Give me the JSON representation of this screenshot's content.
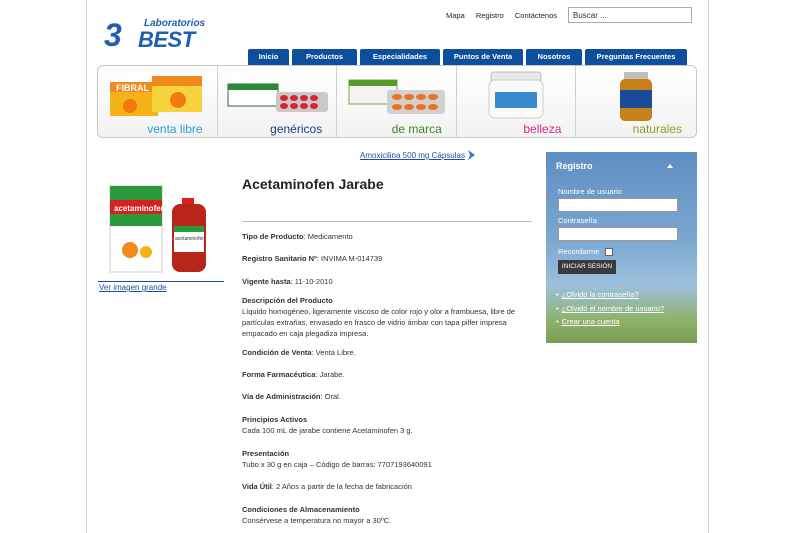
{
  "header": {
    "logo_number": "3",
    "logo_top": "Laboratorios",
    "logo_brand": "BEST",
    "links": [
      "Mapa",
      "Registro",
      "Contáctenos"
    ],
    "search_value": "Buscar ..."
  },
  "nav": {
    "tabs": [
      "Inicio",
      "Productos",
      "Especialidades",
      "Puntos de Venta",
      "Nosotros",
      "Preguntas Frecuentes"
    ]
  },
  "categories": [
    {
      "label": "venta libre",
      "color": "#2a9fd6"
    },
    {
      "label": "genéricos",
      "color": "#1a3f7a"
    },
    {
      "label": "de marca",
      "color": "#3a8a1c"
    },
    {
      "label": "belleza",
      "color": "#d6278a"
    },
    {
      "label": "naturales",
      "color": "#8aa01e"
    }
  ],
  "next_product": "Amoxicilina 500 mg Cápsulas",
  "product": {
    "view_large": "Ver imagen grande",
    "title": "Acetaminofen Jarabe",
    "box_brand": "acetaminofen",
    "bottle_brand": "acetaminofen",
    "fields": [
      {
        "label": "Tipo de Producto",
        "value": ": Medicamento"
      },
      {
        "label": "Registro Sanitario Nº",
        "value": ": INVIMA M-014739"
      },
      {
        "label": "Vigente hasta",
        "value": ": 11-10-2010"
      },
      {
        "label": "Descripción del Producto",
        "value": "Líquido homogéneo, ligeramente viscoso de color rojo y olor a frambuesa, libre de partículas extrañas, envasado en frasco de vidrio ámbar con tapa pilfer impresa empacado en caja plegadiza impresa."
      },
      {
        "label": "Condición de Venta",
        "value": ": Venta Libre."
      },
      {
        "label": "Forma Farmacéutica",
        "value": ": Jarabe."
      },
      {
        "label": "Vía de Administración",
        "value": ": Oral."
      },
      {
        "label": "Principios Activos",
        "value": "Cada 100 mL de jarabe contiene Acetaminofen 3 g."
      },
      {
        "label": "Presentación",
        "value": "Tubo x 30 g en caja – Código de barras: 7707193640091"
      },
      {
        "label": "Vida Útil",
        "value": ": 2 Años a partir de la fecha de fabricación"
      },
      {
        "label": "Condiciones de Almacenamiento",
        "value": "Consérvese a temperatura no mayor a 30ºC."
      }
    ]
  },
  "login": {
    "title": "Registro",
    "username_label": "Nombre de usuario",
    "password_label": "Contraseña",
    "remember_label": "Recordarme",
    "submit_label": "INICIAR SESIÓN",
    "links": [
      "¿Olvidó la contraseña?",
      "¿Olvidó el nombre de usuario?",
      "Crear una cuenta"
    ]
  }
}
